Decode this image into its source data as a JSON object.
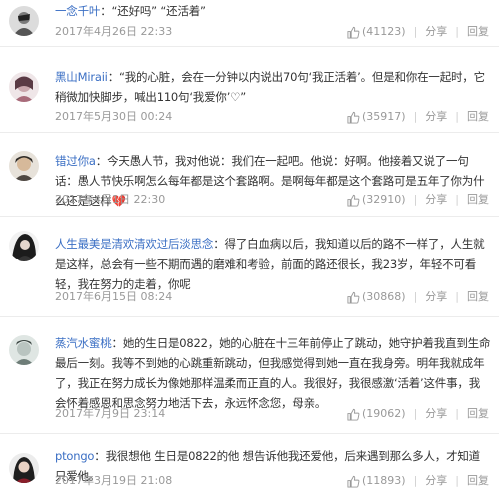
{
  "comments": [
    {
      "user": "一念千叶",
      "text": "“还好吗” “还活着”",
      "date": "2017年4月26日 22:33",
      "likes": "(41123)",
      "share": "分享",
      "reply": "回复"
    },
    {
      "user": "黑山Miraii",
      "text": "“我的心脏，会在一分钟以内说出70句‘我正活着’。但是和你在一起时，它稍微加快脚步，喊出110句‘我爱你’♡”",
      "date": "2017年5月30日 00:24",
      "likes": "(35917)",
      "share": "分享",
      "reply": "回复"
    },
    {
      "user": "错过你a",
      "text": "今天愚人节，我对他说：我们在一起吧。他说：好啊。他接着又说了一句话：愚人节快乐啊怎么每年都是这个套路啊。是啊每年都是这个套路可是五年了你为什么还是这样",
      "emoji": "💔",
      "date": "2017年4月1日 22:30",
      "likes": "(32910)",
      "share": "分享",
      "reply": "回复"
    },
    {
      "user": "人生最美是清欢清欢过后淡思念",
      "text": "得了白血病以后，我知道以后的路不一样了，人生就是这样，总会有一些不期而遇的磨难和考验，前面的路还很长，我23岁，年轻不可看轻，我在努力的走着，你呢",
      "date": "2017年6月15日 08:24",
      "likes": "(30868)",
      "share": "分享",
      "reply": "回复"
    },
    {
      "user": "蒸汽水蜜桃",
      "text": "她的生日是0822，她的心脏在十三年前停止了跳动，她守护着我直到生命最后一刻。我等不到她的心跳重新跳动，但我感觉得到她一直在我身旁。明年我就成年了，我正在努力成长为像她那样温柔而正直的人。我很好，我很感激‘活着’这件事，我会怀着感恩和思念努力地活下去，永远怀念您，母亲。",
      "date": "2017年7月9日 23:14",
      "likes": "(19062)",
      "share": "分享",
      "reply": "回复"
    },
    {
      "user": "ptongo",
      "text": "我很想他 生日是0822的他 想告诉他我还爱他，后来遇到那么多人，才知道只爱他。",
      "date": "2017年3月19日 21:08",
      "likes": "(11893)",
      "share": "分享",
      "reply": "回复"
    }
  ],
  "colors": {
    "username": "#3b6fc4",
    "text": "#333333",
    "meta": "#999999"
  }
}
